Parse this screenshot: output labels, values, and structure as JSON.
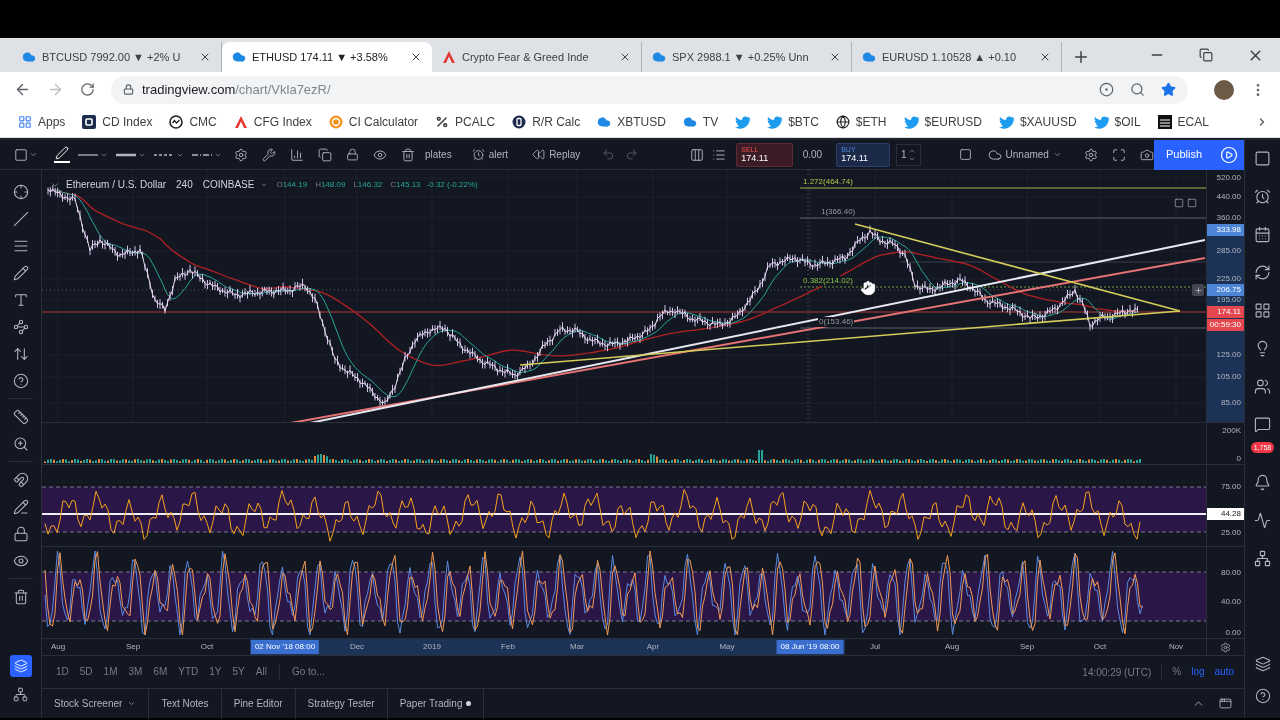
{
  "browser": {
    "tabs": [
      {
        "title": "BTCUSD 7992.00 ▼ +2% U",
        "selected": false
      },
      {
        "title": "ETHUSD 174.11 ▼ +3.58%",
        "selected": true
      },
      {
        "title": "Crypto Fear & Greed Inde",
        "selected": false
      },
      {
        "title": "SPX 2988.1 ▼ +0.25% Unn",
        "selected": false
      },
      {
        "title": "EURUSD 1.10528 ▲ +0.10",
        "selected": false
      }
    ],
    "address": {
      "host": "tradingview.com",
      "path": "/chart/Vkla7ezR/"
    },
    "bookmarks": [
      {
        "kind": "link",
        "label": "Apps"
      },
      {
        "kind": "link",
        "label": "CD Index"
      },
      {
        "kind": "link",
        "label": "CMC"
      },
      {
        "kind": "link",
        "label": "CFG Index"
      },
      {
        "kind": "link",
        "label": "CI Calculator"
      },
      {
        "kind": "link",
        "label": "PCALC"
      },
      {
        "kind": "link",
        "label": "R/R Calc"
      },
      {
        "kind": "link",
        "label": "XBTUSD"
      },
      {
        "kind": "link",
        "label": "TV"
      },
      {
        "kind": "icon"
      },
      {
        "kind": "link",
        "label": "$BTC"
      },
      {
        "kind": "link",
        "label": "$ETH"
      },
      {
        "kind": "link",
        "label": "$EURUSD"
      },
      {
        "kind": "link",
        "label": "$XAUUSD"
      },
      {
        "kind": "link",
        "label": "$OIL"
      },
      {
        "kind": "link",
        "label": "ECAL"
      }
    ]
  },
  "tradingview": {
    "toolbar": {
      "templates": "plates",
      "alert": "alert",
      "replay": "Replay",
      "sell": {
        "label": "SELL",
        "price": "174.11"
      },
      "spread": "0.00",
      "buy": {
        "label": "BUY",
        "price": "174.11"
      },
      "quantity": "1",
      "layout": "Unnamed",
      "publish": "Publish"
    },
    "legend": {
      "symbol": "Ethereum / U.S. Dollar",
      "interval": "240",
      "exchange": "COINBASE",
      "ohlc": [
        {
          "key": "O",
          "value": "144.19"
        },
        {
          "key": "H",
          "value": "148.09"
        },
        {
          "key": "L",
          "value": "146.32"
        },
        {
          "key": "C",
          "value": "145.13"
        }
      ],
      "change": "-0.32 (-0.22%)"
    },
    "fib_levels": [
      "1.272(464.74)",
      "1(366.40)",
      "0.382(214.02)",
      "0(153.46)"
    ],
    "price_scale": [
      "520.00",
      "440.00",
      "360.00",
      "285.00",
      "225.00",
      "195.00",
      "125.00",
      "105.00",
      "85.00"
    ],
    "price_tags": [
      {
        "text": "333.98",
        "color": "#4d86d6"
      },
      {
        "text": "206.75",
        "color": "#4d86d6"
      },
      {
        "text": "174.11",
        "color": "#e5474f"
      },
      {
        "text": "00:59:30",
        "color": "#e5474f"
      }
    ],
    "volume_scale": [
      "200K",
      "0"
    ],
    "rsi_scale": [
      "75.00",
      "25.00"
    ],
    "rsi_tag": {
      "text": "44.28",
      "color": "#ffffff"
    },
    "stoch_scale": [
      "80.00",
      "40.00",
      "0.00"
    ],
    "time_axis": [
      {
        "kind": "tick",
        "label": "Aug"
      },
      {
        "kind": "tick",
        "label": "Sep"
      },
      {
        "kind": "tick",
        "label": "Oct"
      },
      {
        "kind": "tag",
        "label": "02 Nov '18 08:00"
      },
      {
        "kind": "tick",
        "label": "Dec"
      },
      {
        "kind": "tick",
        "label": "2019"
      },
      {
        "kind": "tick",
        "label": "Feb"
      },
      {
        "kind": "tick",
        "label": "Mar"
      },
      {
        "kind": "tick",
        "label": "Apr"
      },
      {
        "kind": "tick",
        "label": "May"
      },
      {
        "kind": "tag",
        "label": "08 Jun '19 08:00"
      },
      {
        "kind": "tick",
        "label": "Jul"
      },
      {
        "kind": "tick",
        "label": "Aug"
      },
      {
        "kind": "tick",
        "label": "Sep"
      },
      {
        "kind": "tick",
        "label": "Oct"
      },
      {
        "kind": "tick",
        "label": "Nov"
      }
    ],
    "ranges": [
      "1D",
      "5D",
      "1M",
      "3M",
      "6M",
      "YTD",
      "1Y",
      "5Y",
      "All"
    ],
    "goto": "Go to...",
    "clock": "14:00:29 (UTC)",
    "scale_modes": [
      {
        "label": "%",
        "selected": false
      },
      {
        "label": "log",
        "selected": true
      },
      {
        "label": "auto",
        "selected": true
      }
    ],
    "bottom_tabs": [
      {
        "kind": "dropdown",
        "label": "Stock Screener"
      },
      {
        "kind": "plain",
        "label": "Text Notes"
      },
      {
        "kind": "plain",
        "label": "Pine Editor"
      },
      {
        "kind": "plain",
        "label": "Strategy Tester"
      },
      {
        "kind": "status",
        "label": "Paper Trading"
      }
    ],
    "notification_count": "1,758"
  }
}
